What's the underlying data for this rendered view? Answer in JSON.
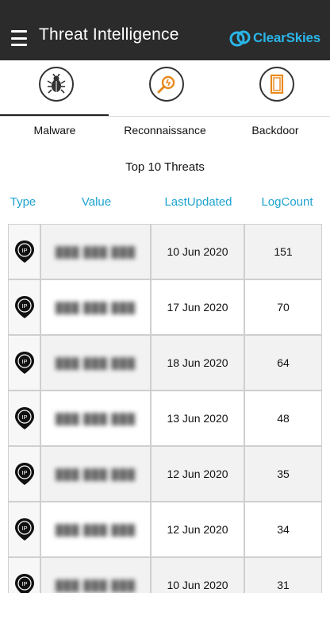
{
  "header": {
    "title": "Threat Intelligence",
    "brand": "ClearSkies"
  },
  "tabs": [
    {
      "label": "Malware",
      "icon": "bug-icon",
      "active": true
    },
    {
      "label": "Reconnaissance",
      "icon": "magnifier-icon",
      "active": false
    },
    {
      "label": "Backdoor",
      "icon": "door-icon",
      "active": false
    }
  ],
  "section_title": "Top 10 Threats",
  "columns": {
    "type": "Type",
    "value": "Value",
    "last_updated": "LastUpdated",
    "log_count": "LogCount"
  },
  "rows": [
    {
      "type": "IP",
      "value": "███ ███ ███",
      "last_updated": "10 Jun 2020",
      "log_count": "151"
    },
    {
      "type": "IP",
      "value": "███ ███ ███",
      "last_updated": "17 Jun 2020",
      "log_count": "70"
    },
    {
      "type": "IP",
      "value": "███ ███ ███",
      "last_updated": "18 Jun 2020",
      "log_count": "64"
    },
    {
      "type": "IP",
      "value": "███ ███ ███",
      "last_updated": "13 Jun 2020",
      "log_count": "48"
    },
    {
      "type": "IP",
      "value": "███ ███ ███",
      "last_updated": "12 Jun 2020",
      "log_count": "35"
    },
    {
      "type": "IP",
      "value": "███ ███ ███",
      "last_updated": "12 Jun 2020",
      "log_count": "34"
    },
    {
      "type": "IP",
      "value": "███ ███ ███",
      "last_updated": "10 Jun 2020",
      "log_count": "31"
    }
  ],
  "colors": {
    "header_bg": "#2b2b2b",
    "accent": "#1ea3cf",
    "brand": "#29b5e8",
    "icon_orange": "#e8891c"
  }
}
